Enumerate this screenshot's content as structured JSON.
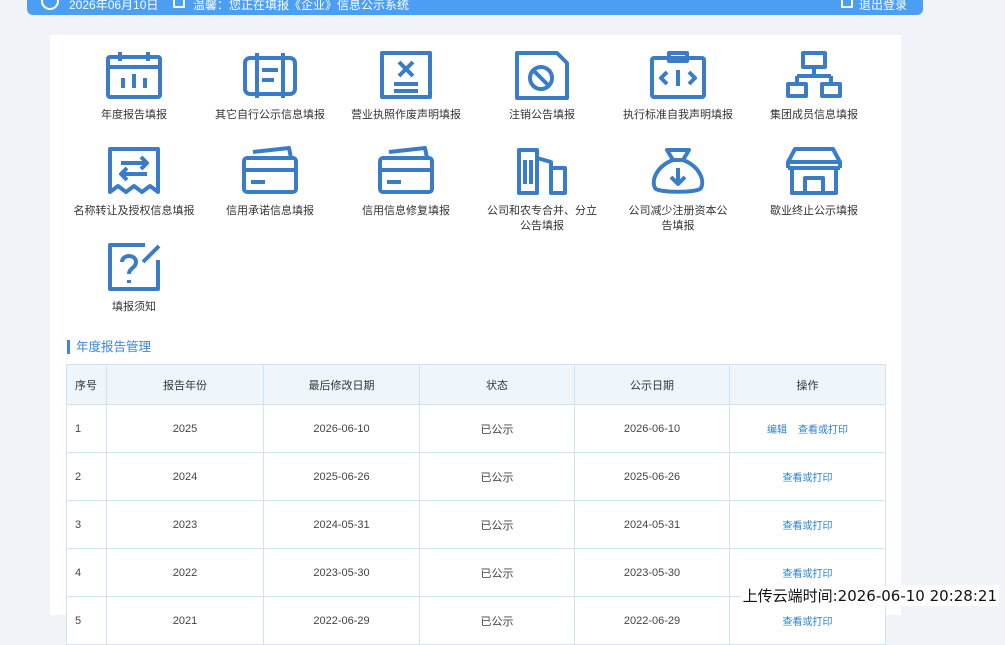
{
  "header": {
    "date_text": "2026年06月10日",
    "notice_text": "温馨：您正在填报《企业》信息公示系统",
    "logout_label": "退出登录"
  },
  "icon_color": "#3a7cc8",
  "grid": [
    {
      "id": "annual",
      "label": "年度报告填报",
      "icon": "calendar-icon"
    },
    {
      "id": "other",
      "label": "其它自行公示信息填报",
      "icon": "signboard-icon"
    },
    {
      "id": "license",
      "label": "营业执照作废声明填报",
      "icon": "cancelled-document-icon"
    },
    {
      "id": "cancel",
      "label": "注销公告填报",
      "icon": "prohibited-document-icon"
    },
    {
      "id": "standard",
      "label": "执行标准自我声明填报",
      "icon": "code-clipboard-icon"
    },
    {
      "id": "group",
      "label": "集团成员信息填报",
      "icon": "org-chart-icon"
    },
    {
      "id": "transfer",
      "label": "名称转让及授权信息填报",
      "icon": "transfer-receipt-icon"
    },
    {
      "id": "promise",
      "label": "信用承诺信息填报",
      "icon": "credit-card-icon"
    },
    {
      "id": "repair",
      "label": "信用信息修复填报",
      "icon": "credit-card-icon"
    },
    {
      "id": "merge",
      "label": "公司和农专合并、分立公告填报",
      "icon": "buildings-icon"
    },
    {
      "id": "reduce",
      "label": "公司减少注册资本公告填报",
      "icon": "money-bag-icon"
    },
    {
      "id": "closure",
      "label": "歇业终止公示填报",
      "icon": "storefront-icon"
    },
    {
      "id": "notice",
      "label": "填报须知",
      "icon": "question-edit-icon"
    }
  ],
  "section": {
    "title": "年度报告管理"
  },
  "table": {
    "headers": [
      "序号",
      "报告年份",
      "最后修改日期",
      "状态",
      "公示日期",
      "操作"
    ],
    "rows": [
      {
        "idx": "1",
        "year": "2025",
        "modified": "2026-06-10",
        "status": "已公示",
        "published": "2026-06-10",
        "ops": [
          "编辑",
          "查看或打印"
        ]
      },
      {
        "idx": "2",
        "year": "2024",
        "modified": "2025-06-26",
        "status": "已公示",
        "published": "2025-06-26",
        "ops": [
          "查看或打印"
        ]
      },
      {
        "idx": "3",
        "year": "2023",
        "modified": "2024-05-31",
        "status": "已公示",
        "published": "2024-05-31",
        "ops": [
          "查看或打印"
        ]
      },
      {
        "idx": "4",
        "year": "2022",
        "modified": "2023-05-30",
        "status": "已公示",
        "published": "2023-05-30",
        "ops": [
          "查看或打印"
        ]
      },
      {
        "idx": "5",
        "year": "2021",
        "modified": "2022-06-29",
        "status": "已公示",
        "published": "2022-06-29",
        "ops": [
          "查看或打印"
        ]
      }
    ]
  },
  "watermark": "上传云端时间:2026-06-10 20:28:21"
}
